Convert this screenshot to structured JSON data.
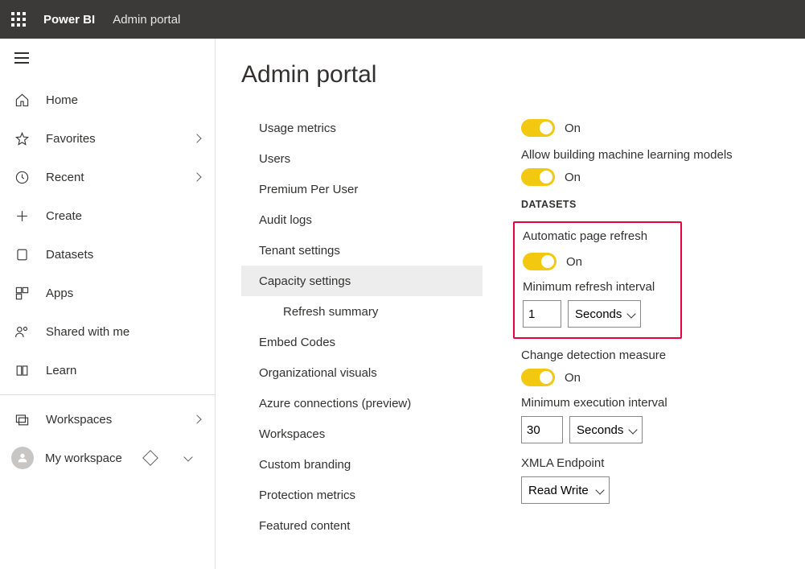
{
  "header": {
    "brand": "Power BI",
    "portal": "Admin portal"
  },
  "sidebar": {
    "items": [
      {
        "label": "Home",
        "expandable": false
      },
      {
        "label": "Favorites",
        "expandable": true
      },
      {
        "label": "Recent",
        "expandable": true
      },
      {
        "label": "Create",
        "expandable": false
      },
      {
        "label": "Datasets",
        "expandable": false
      },
      {
        "label": "Apps",
        "expandable": false
      },
      {
        "label": "Shared with me",
        "expandable": false
      },
      {
        "label": "Learn",
        "expandable": false
      }
    ],
    "workspaces_label": "Workspaces",
    "my_workspace_label": "My workspace"
  },
  "page": {
    "title": "Admin portal"
  },
  "subnav": {
    "items": [
      {
        "label": "Usage metrics"
      },
      {
        "label": "Users"
      },
      {
        "label": "Premium Per User"
      },
      {
        "label": "Audit logs"
      },
      {
        "label": "Tenant settings"
      },
      {
        "label": "Capacity settings",
        "selected": true
      },
      {
        "label": "Refresh summary",
        "sub": true
      },
      {
        "label": "Embed Codes"
      },
      {
        "label": "Organizational visuals"
      },
      {
        "label": "Azure connections (preview)"
      },
      {
        "label": "Workspaces"
      },
      {
        "label": "Custom branding"
      },
      {
        "label": "Protection metrics"
      },
      {
        "label": "Featured content"
      }
    ]
  },
  "settings": {
    "top_toggle_on_label": "On",
    "allow_ml_label": "Allow building machine learning models",
    "allow_ml_on_label": "On",
    "datasets_heading": "DATASETS",
    "auto_refresh_label": "Automatic page refresh",
    "auto_refresh_on_label": "On",
    "min_refresh_label": "Minimum refresh interval",
    "min_refresh_value": "1",
    "min_refresh_unit": "Seconds",
    "change_detection_label": "Change detection measure",
    "change_detection_on_label": "On",
    "min_exec_label": "Minimum execution interval",
    "min_exec_value": "30",
    "min_exec_unit": "Seconds",
    "xmla_label": "XMLA Endpoint",
    "xmla_value": "Read Write"
  }
}
